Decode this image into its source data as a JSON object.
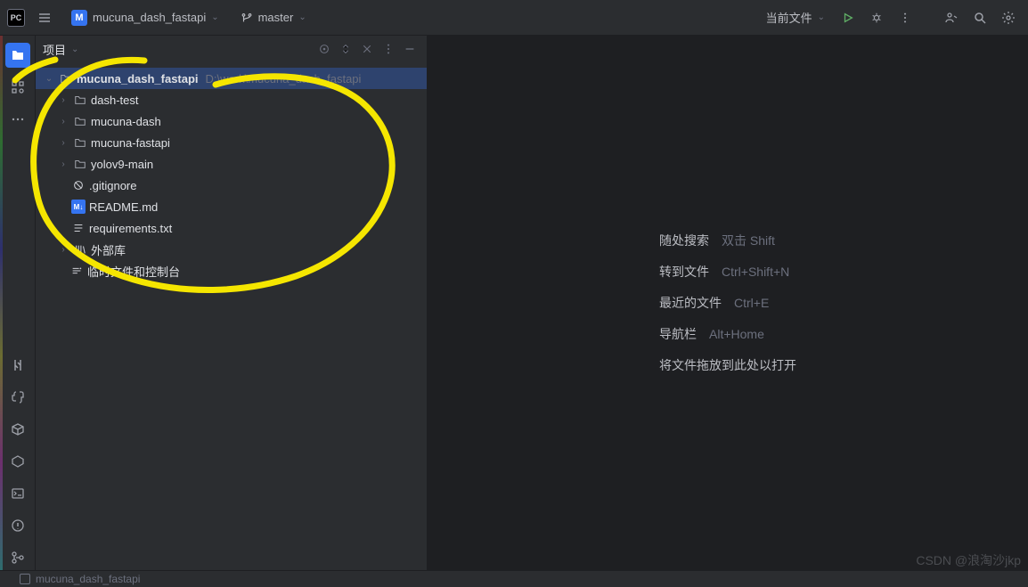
{
  "title_bar": {
    "app_logo_text": "PC",
    "project_name": "mucuna_dash_fastapi",
    "branch_name": "master",
    "run_config": "当前文件"
  },
  "panel": {
    "title": "项目"
  },
  "tree": {
    "root_name": "mucuna_dash_fastapi",
    "root_path": "D:\\work\\mucuna_dash_fastapi",
    "folders": [
      "dash-test",
      "mucuna-dash",
      "mucuna-fastapi",
      "yolov9-main"
    ],
    "gitignore": ".gitignore",
    "readme_prefix": "M↓",
    "readme": "README.md",
    "requirements": "requirements.txt",
    "external_lib": "外部库",
    "scratch": "临时文件和控制台"
  },
  "welcome": {
    "search_label": "随处搜索",
    "search_key": "双击 Shift",
    "goto_label": "转到文件",
    "goto_key": "Ctrl+Shift+N",
    "recent_label": "最近的文件",
    "recent_key": "Ctrl+E",
    "nav_label": "导航栏",
    "nav_key": "Alt+Home",
    "drop_text": "将文件拖放到此处以打开"
  },
  "watermark": "CSDN @浪淘沙jkp",
  "status_bar": "mucuna_dash_fastapi"
}
